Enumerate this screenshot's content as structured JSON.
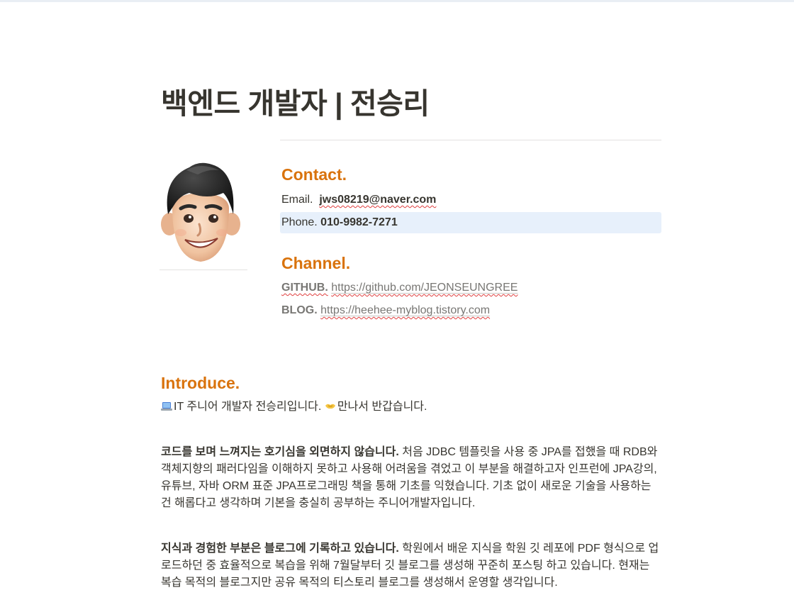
{
  "page": {
    "title": "백엔드 개발자 | 전승리"
  },
  "contact": {
    "heading": "Contact.",
    "email_label": "Email.",
    "email_value": "jws08219@naver.com",
    "phone_label": "Phone.",
    "phone_value": "010-9982-7271"
  },
  "channel": {
    "heading": "Channel.",
    "github_label": "GITHUB.",
    "github_url": "https://github.com/JEONSEUNGREE",
    "blog_label": "BLOG.",
    "blog_url": "https://heehee-myblog.tistory.com"
  },
  "introduce": {
    "heading": "Introduce.",
    "line1_a": "IT 주니어 개발자 전승리입니다.",
    "line1_b": "만나서 반갑습니다.",
    "p1_bold": "코드를 보며 느껴지는 호기심을 외면하지 않습니다.",
    "p1_text": "처음 JDBC 템플릿을 사용 중 JPA를 접했을 때 RDB와 객체지향의 패러다임을 이해하지 못하고 사용해 어려움을 겪었고 이 부분을 해결하고자 인프런에 JPA강의, 유튜브, 자바 ORM 표준 JPA프로그래밍 책을 통해 기초를 익혔습니다. 기초 없이 새로운 기술을 사용하는 건 해롭다고 생각하며 기본을 충실히 공부하는 주니어개발자입니다.",
    "p2_bold": "지식과 경험한 부분은 블로그에 기록하고 있습니다.",
    "p2_text": "학원에서 배운 지식을 학원 깃 레포에 PDF 형식으로 업로드하던 중 효율적으로 복습을 위해 7월달부터 깃 블로그를 생성해 꾸준히 포스팅 하고 있습니다. 현재는 복습 목적의 블로그지만 공유 목적의 티스토리 블로그를 생성해서 운영할 생각입니다."
  },
  "icons": {
    "laptop": "laptop-icon",
    "handshake": "handshake-icon"
  }
}
